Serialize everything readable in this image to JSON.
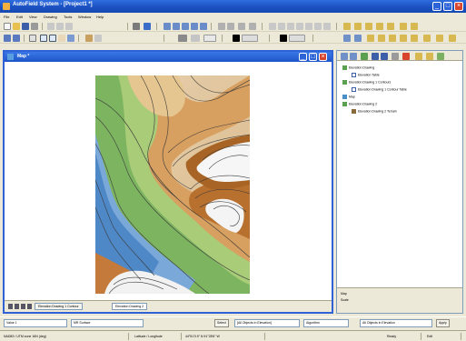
{
  "app": {
    "title": "AutoField System - [Project1 *]"
  },
  "menu": [
    "File",
    "Edit",
    "View",
    "Drawing",
    "Tools",
    "Window",
    "Help"
  ],
  "map_window": {
    "title": "Map *"
  },
  "map_tabs": [
    "Elevation Drawing 1 Contour",
    "Elevation Drawing 2"
  ],
  "tree": [
    {
      "label": "Elevation Drawing",
      "icon": "layer-icon"
    },
    {
      "label": "Elevation Table",
      "icon": "table-icon"
    },
    {
      "label": "Elevation Drawing 1 Contours",
      "icon": "layer-icon"
    },
    {
      "label": "Elevation Drawing 1 Contour Table",
      "icon": "table-icon"
    },
    {
      "label": "Map",
      "icon": "map-icon"
    },
    {
      "label": "Elevation Drawing 2",
      "icon": "layer-icon"
    },
    {
      "label": "Elevation Drawing 2 Terrain",
      "icon": "terrain-icon"
    }
  ],
  "properties": {
    "label1": "Map",
    "label2": "Scale"
  },
  "selection_bar": {
    "combo1": "Value 1",
    "combo2": "MR Surface",
    "select_label": "Select",
    "combo3": "[All Objects in Elevation]",
    "combo4": "Algorithm",
    "combo5": "All Objects in Elevation",
    "apply_label": "Apply"
  },
  "status": {
    "coords": "NAD83 / UTM zone 16N (deg)",
    "latlong_label": "Latitude / Longitude",
    "latlong_value": "44°51'0.9\" N 91°28'6\" W",
    "state": "Ready",
    "mode": "Edit"
  },
  "colors": {
    "titlebar": "#1A4FBF",
    "window_border": "#2E62D6",
    "chrome": "#ECE9D8"
  }
}
